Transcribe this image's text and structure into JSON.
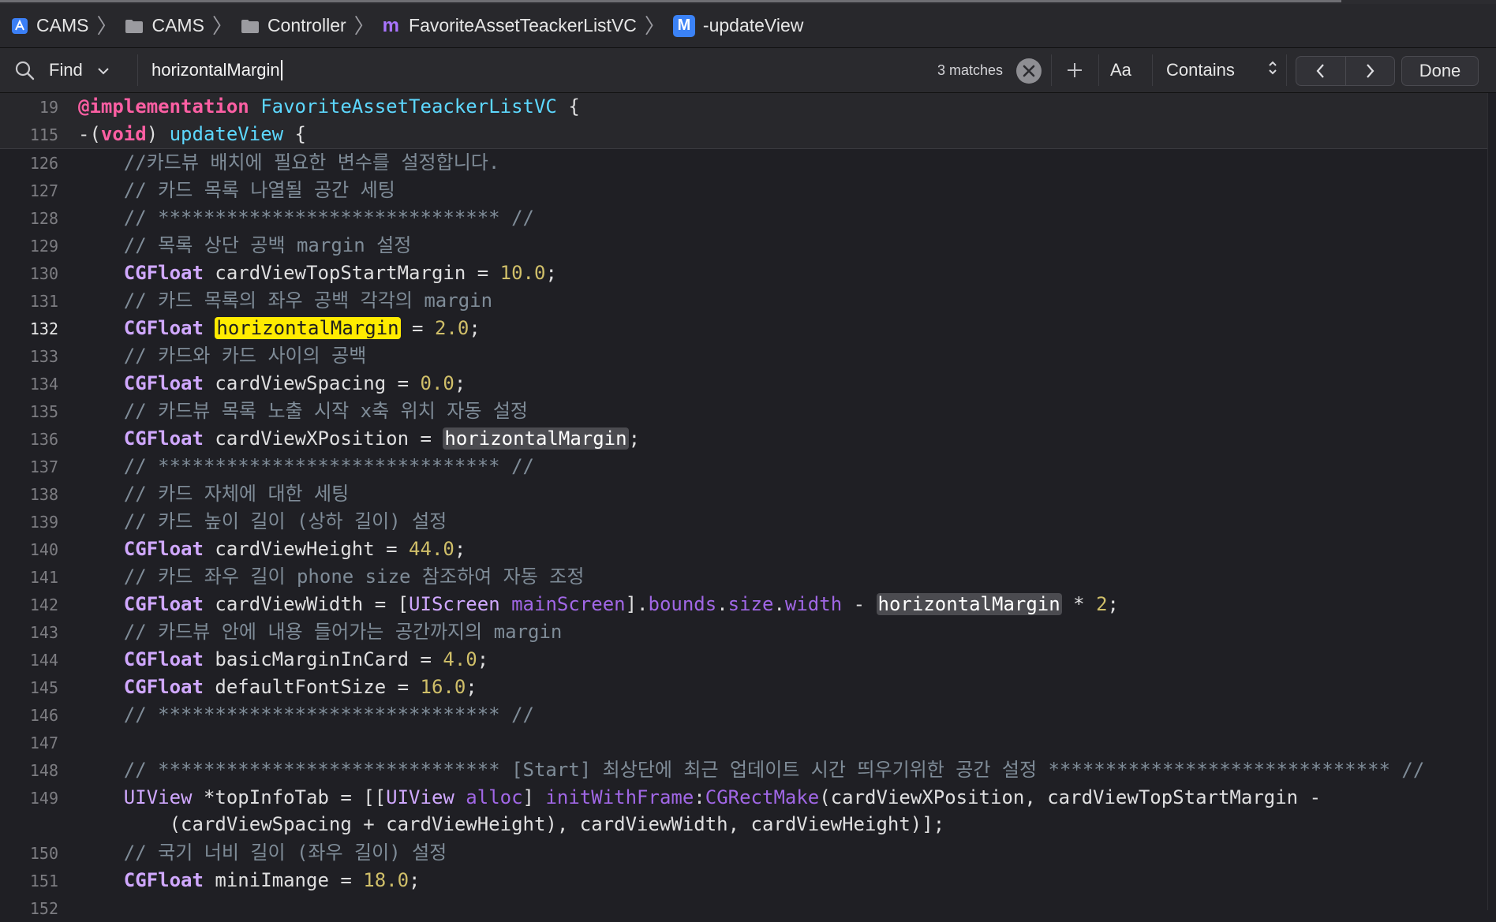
{
  "breadcrumb": {
    "items": [
      {
        "label": "CAMS",
        "icon": "xcode-project-icon"
      },
      {
        "label": "CAMS",
        "icon": "folder-icon"
      },
      {
        "label": "Controller",
        "icon": "folder-icon"
      },
      {
        "label": "FavoriteAssetTeackerListVC",
        "icon": "m-file-icon",
        "badge": "m"
      },
      {
        "label": "-updateView",
        "icon": "method-icon",
        "badge": "M"
      }
    ]
  },
  "find_bar": {
    "mode": "Find",
    "query": "horizontalMargin",
    "matches": "3 matches",
    "case_label": "Aa",
    "match_type": "Contains",
    "done_label": "Done"
  },
  "sticky_header": [
    {
      "line": "19",
      "tokens": [
        [
          "kw",
          "@implementation"
        ],
        [
          "t",
          " "
        ],
        [
          "cls",
          "FavoriteAssetTeackerListVC"
        ],
        [
          "t",
          " {"
        ]
      ]
    },
    {
      "line": "115",
      "tokens": [
        [
          "t",
          "-("
        ],
        [
          "kw",
          "void"
        ],
        [
          "t",
          ") "
        ],
        [
          "cls",
          "updateView"
        ],
        [
          "t",
          " {"
        ]
      ]
    }
  ],
  "code_lines": [
    {
      "line": "126",
      "tokens": [
        [
          "t",
          "    "
        ],
        [
          "com",
          "//카드뷰 배치에 필요한 변수를 설정합니다."
        ]
      ]
    },
    {
      "line": "127",
      "tokens": [
        [
          "t",
          "    "
        ],
        [
          "com",
          "// 카드 목록 나열될 공간 세팅"
        ]
      ]
    },
    {
      "line": "128",
      "tokens": [
        [
          "t",
          "    "
        ],
        [
          "com",
          "// ****************************** //"
        ]
      ]
    },
    {
      "line": "129",
      "tokens": [
        [
          "t",
          "    "
        ],
        [
          "com",
          "// 목록 상단 공백 margin 설정"
        ]
      ]
    },
    {
      "line": "130",
      "tokens": [
        [
          "t",
          "    "
        ],
        [
          "ty",
          "CGFloat"
        ],
        [
          "t",
          " cardViewTopStartMargin = "
        ],
        [
          "num",
          "10.0"
        ],
        [
          "t",
          ";"
        ]
      ]
    },
    {
      "line": "131",
      "tokens": [
        [
          "t",
          "    "
        ],
        [
          "com",
          "// 카드 목록의 좌우 공백 각각의 margin"
        ]
      ]
    },
    {
      "line": "132",
      "current": true,
      "tokens": [
        [
          "t",
          "    "
        ],
        [
          "ty",
          "CGFloat"
        ],
        [
          "t",
          " "
        ],
        [
          "hl-cur",
          "horizontalMargin"
        ],
        [
          "t",
          " = "
        ],
        [
          "num",
          "2.0"
        ],
        [
          "t",
          ";"
        ]
      ]
    },
    {
      "line": "133",
      "tokens": [
        [
          "t",
          "    "
        ],
        [
          "com",
          "// 카드와 카드 사이의 공백"
        ]
      ]
    },
    {
      "line": "134",
      "tokens": [
        [
          "t",
          "    "
        ],
        [
          "ty",
          "CGFloat"
        ],
        [
          "t",
          " cardViewSpacing = "
        ],
        [
          "num",
          "0.0"
        ],
        [
          "t",
          ";"
        ]
      ]
    },
    {
      "line": "135",
      "tokens": [
        [
          "t",
          "    "
        ],
        [
          "com",
          "// 카드뷰 목록 노출 시작 x축 위치 자동 설정"
        ]
      ]
    },
    {
      "line": "136",
      "tokens": [
        [
          "t",
          "    "
        ],
        [
          "ty",
          "CGFloat"
        ],
        [
          "t",
          " cardViewXPosition = "
        ],
        [
          "hl",
          "horizontalMargin"
        ],
        [
          "t",
          ";"
        ]
      ]
    },
    {
      "line": "137",
      "tokens": [
        [
          "t",
          "    "
        ],
        [
          "com",
          "// ****************************** //"
        ]
      ]
    },
    {
      "line": "138",
      "tokens": [
        [
          "t",
          "    "
        ],
        [
          "com",
          "// 카드 자체에 대한 세팅"
        ]
      ]
    },
    {
      "line": "139",
      "tokens": [
        [
          "t",
          "    "
        ],
        [
          "com",
          "// 카드 높이 길이 (상하 길이) 설정"
        ]
      ]
    },
    {
      "line": "140",
      "tokens": [
        [
          "t",
          "    "
        ],
        [
          "ty",
          "CGFloat"
        ],
        [
          "t",
          " cardViewHeight = "
        ],
        [
          "num",
          "44.0"
        ],
        [
          "t",
          ";"
        ]
      ]
    },
    {
      "line": "141",
      "tokens": [
        [
          "t",
          "    "
        ],
        [
          "com",
          "// 카드 좌우 길이 phone size 참조하여 자동 조정"
        ]
      ]
    },
    {
      "line": "142",
      "tokens": [
        [
          "t",
          "    "
        ],
        [
          "ty",
          "CGFloat"
        ],
        [
          "t",
          " cardViewWidth = ["
        ],
        [
          "cls2",
          "UIScreen"
        ],
        [
          "t",
          " "
        ],
        [
          "meth",
          "mainScreen"
        ],
        [
          "t",
          "]."
        ],
        [
          "prop",
          "bounds"
        ],
        [
          "t",
          "."
        ],
        [
          "prop",
          "size"
        ],
        [
          "t",
          "."
        ],
        [
          "prop",
          "width"
        ],
        [
          "t",
          " - "
        ],
        [
          "hl",
          "horizontalMargin"
        ],
        [
          "t",
          " * "
        ],
        [
          "num",
          "2"
        ],
        [
          "t",
          ";"
        ]
      ]
    },
    {
      "line": "143",
      "tokens": [
        [
          "t",
          "    "
        ],
        [
          "com",
          "// 카드뷰 안에 내용 들어가는 공간까지의 margin"
        ]
      ]
    },
    {
      "line": "144",
      "tokens": [
        [
          "t",
          "    "
        ],
        [
          "ty",
          "CGFloat"
        ],
        [
          "t",
          " basicMarginInCard = "
        ],
        [
          "num",
          "4.0"
        ],
        [
          "t",
          ";"
        ]
      ]
    },
    {
      "line": "145",
      "tokens": [
        [
          "t",
          "    "
        ],
        [
          "ty",
          "CGFloat"
        ],
        [
          "t",
          " defaultFontSize = "
        ],
        [
          "num",
          "16.0"
        ],
        [
          "t",
          ";"
        ]
      ]
    },
    {
      "line": "146",
      "tokens": [
        [
          "t",
          "    "
        ],
        [
          "com",
          "// ****************************** //"
        ]
      ]
    },
    {
      "line": "147",
      "tokens": [
        [
          "t",
          " "
        ]
      ]
    },
    {
      "line": "148",
      "tokens": [
        [
          "t",
          "    "
        ],
        [
          "com",
          "// ****************************** [Start] 최상단에 최근 업데이트 시간 띄우기위한 공간 설정 ****************************** //"
        ]
      ]
    },
    {
      "line": "149",
      "tall": true,
      "tokens": [
        [
          "t",
          "    "
        ],
        [
          "cls2",
          "UIView"
        ],
        [
          "t",
          " *topInfoTab = [["
        ],
        [
          "cls2",
          "UIView"
        ],
        [
          "t",
          " "
        ],
        [
          "meth",
          "alloc"
        ],
        [
          "t",
          "] "
        ],
        [
          "meth",
          "initWithFrame"
        ],
        [
          "t",
          ":"
        ],
        [
          "meth",
          "CGRectMake"
        ],
        [
          "t",
          "(cardViewXPosition, cardViewTopStartMargin -\n        (cardViewSpacing + cardViewHeight), cardViewWidth, cardViewHeight)];"
        ]
      ]
    },
    {
      "line": "150",
      "tokens": [
        [
          "t",
          "    "
        ],
        [
          "com",
          "// 국기 너비 길이 (좌우 길이) 설정"
        ]
      ]
    },
    {
      "line": "151",
      "tokens": [
        [
          "t",
          "    "
        ],
        [
          "ty",
          "CGFloat"
        ],
        [
          "t",
          " miniImange = "
        ],
        [
          "num",
          "18.0"
        ],
        [
          "t",
          ";"
        ]
      ]
    },
    {
      "line": "152",
      "tokens": [
        [
          "t",
          " "
        ]
      ]
    }
  ]
}
